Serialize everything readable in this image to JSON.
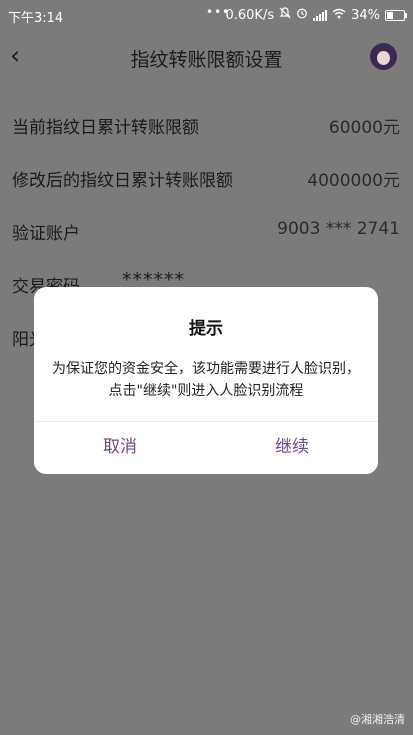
{
  "status_bar": {
    "time": "下午3:14",
    "dots": "•••",
    "network_speed": "0.60K/s",
    "battery": "34%"
  },
  "nav": {
    "title": "指纹转账限额设置",
    "back_glyph": "‹"
  },
  "form": {
    "rows": [
      {
        "label": "当前指纹日累计转账限额",
        "value": "60000元"
      },
      {
        "label": "修改后的指纹日累计转账限额",
        "value": "4000000元"
      },
      {
        "label": "验证账户",
        "value": "9003 *** 2741"
      },
      {
        "label": "交易密码",
        "value": "******"
      },
      {
        "label": "阳光"
      }
    ]
  },
  "dialog": {
    "title": "提示",
    "message": "为保证您的资金安全，该功能需要进行人脸识别，点击\"继续\"则进入人脸识别流程",
    "cancel_label": "取消",
    "continue_label": "继续"
  },
  "watermark": "@湘湘浩清",
  "colors": {
    "overlay_bg": "#7b7b7b",
    "accent": "#6b4a85",
    "dialog_bg": "#ffffff"
  }
}
